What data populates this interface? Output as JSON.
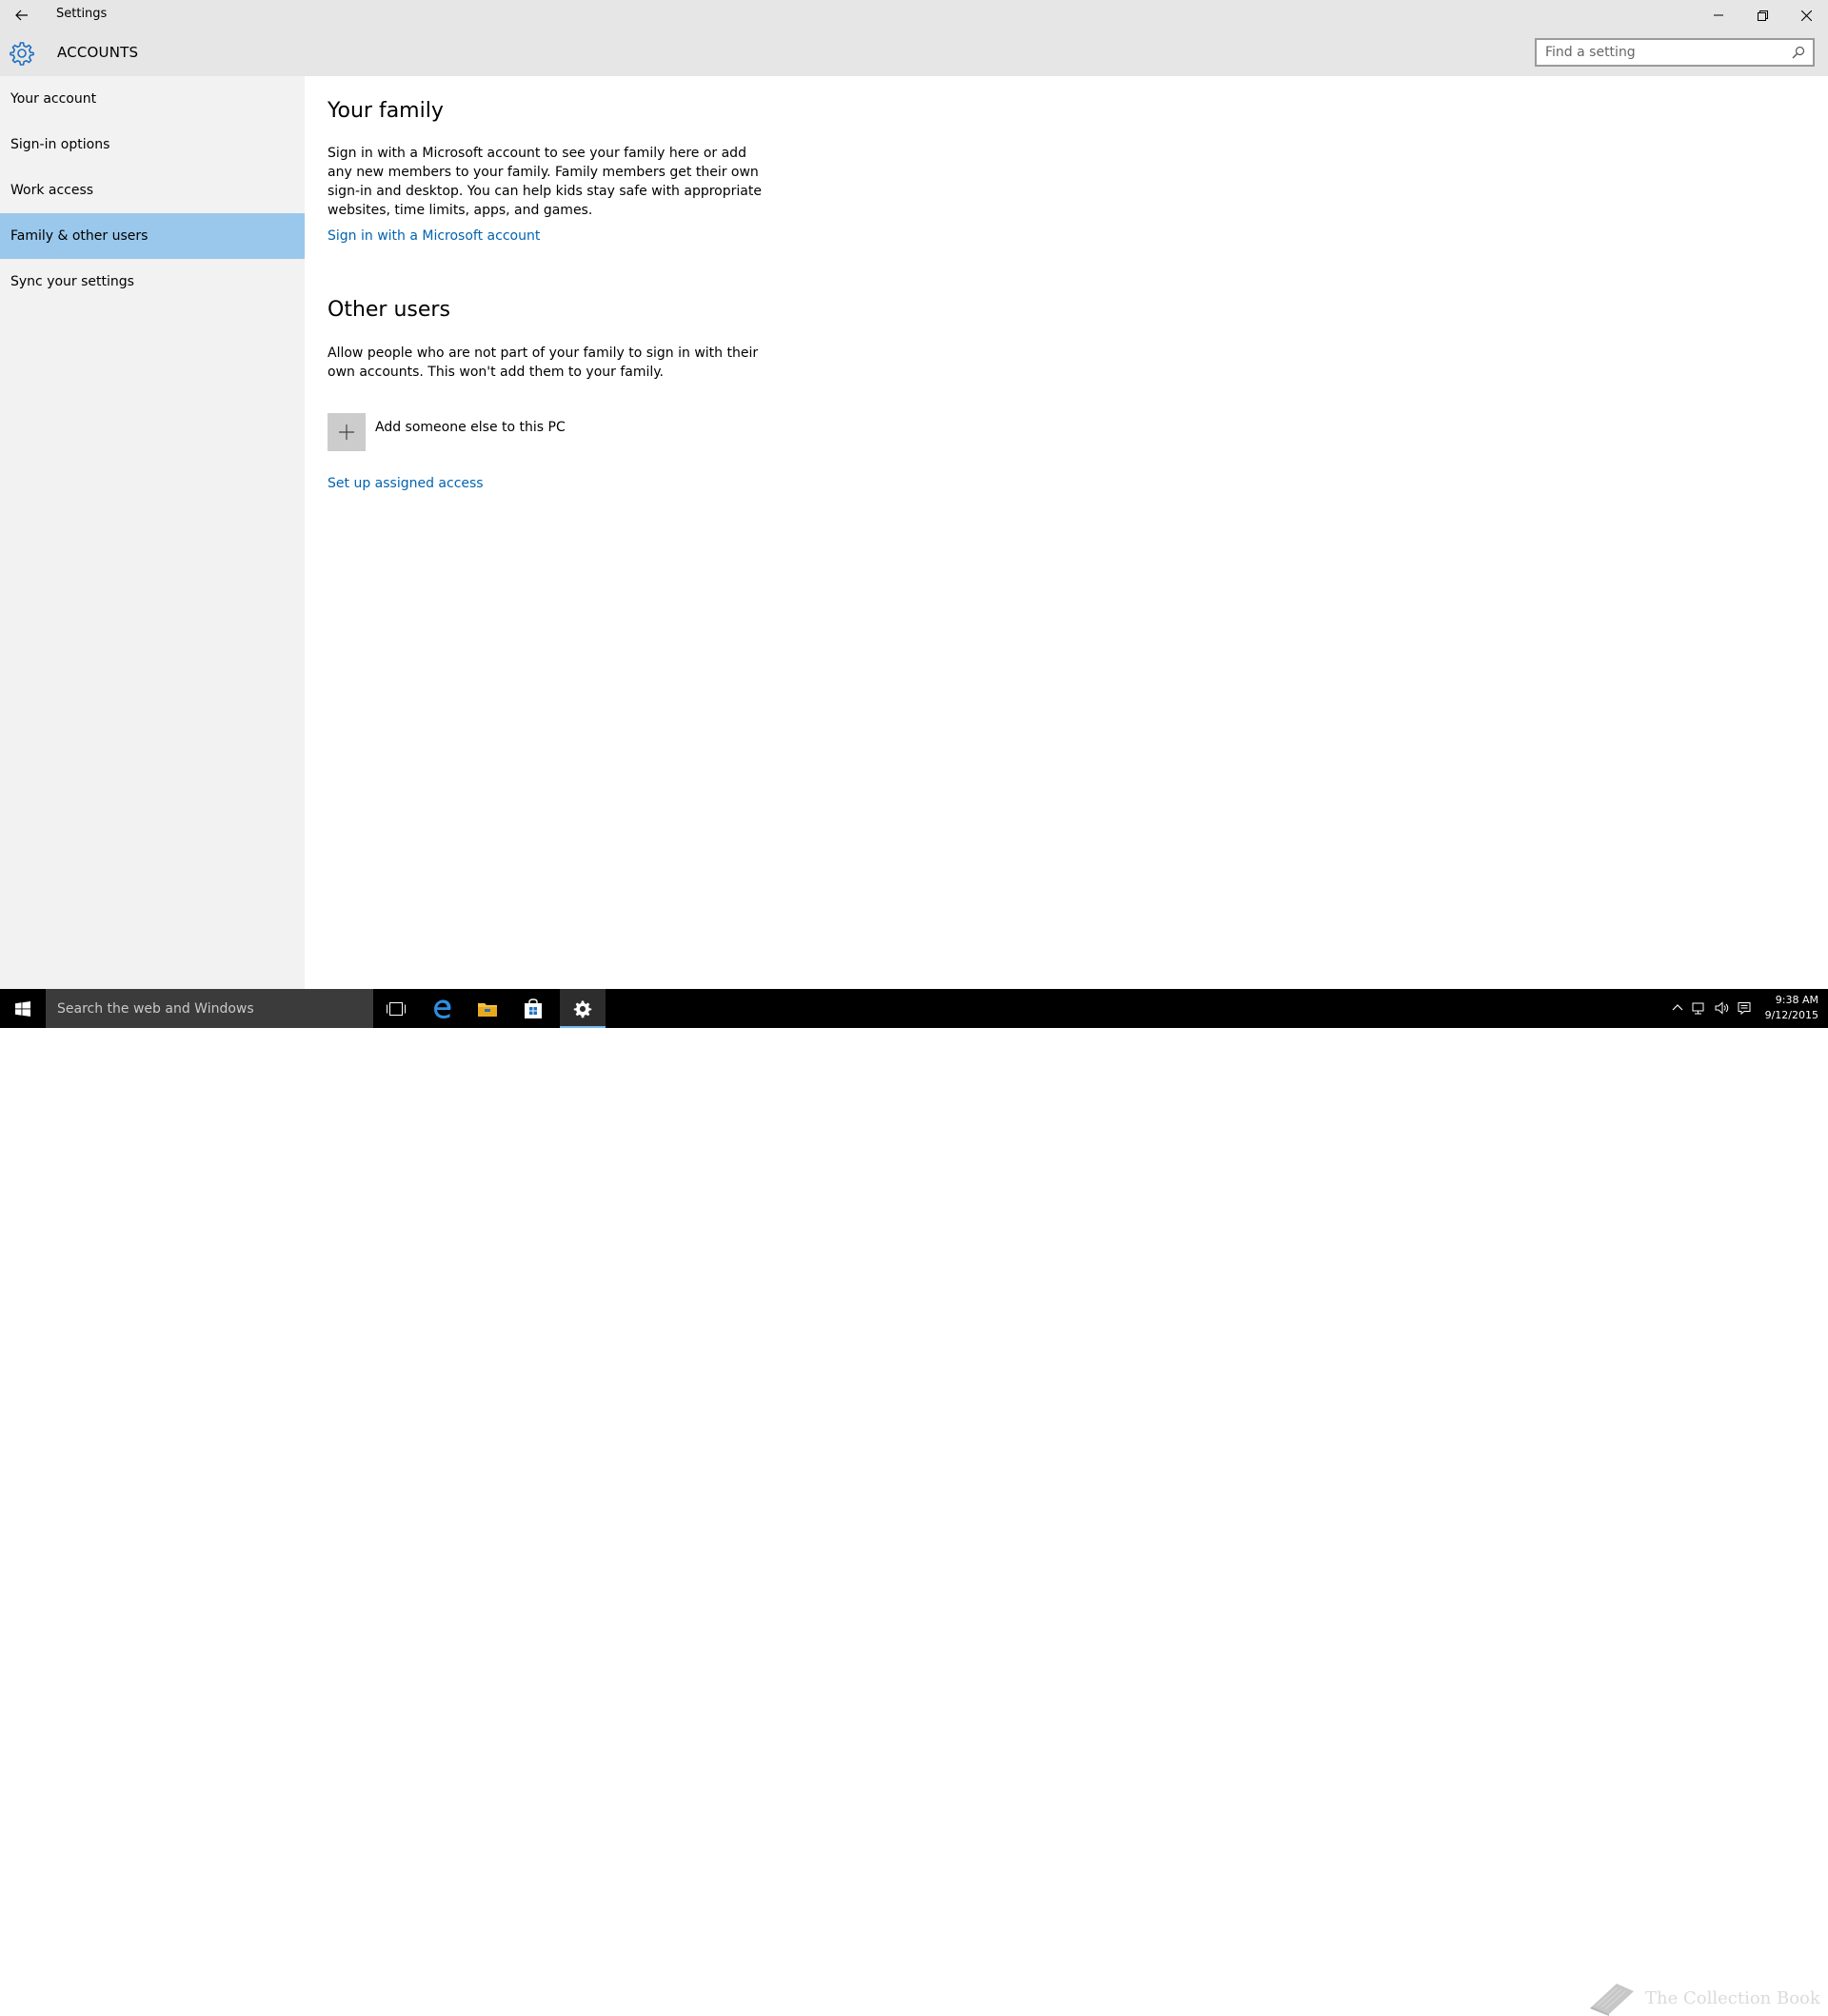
{
  "window": {
    "title": "Settings",
    "app_title": "ACCOUNTS"
  },
  "search": {
    "placeholder": "Find a setting"
  },
  "sidebar": {
    "items": [
      {
        "label": "Your account",
        "selected": false
      },
      {
        "label": "Sign-in options",
        "selected": false
      },
      {
        "label": "Work access",
        "selected": false
      },
      {
        "label": "Family & other users",
        "selected": true
      },
      {
        "label": "Sync your settings",
        "selected": false
      }
    ]
  },
  "family": {
    "heading": "Your family",
    "description": "Sign in with a Microsoft account to see your family here or add any new members to your family. Family members get their own sign-in and desktop. You can help kids stay safe with appropriate websites, time limits, apps, and games.",
    "link": "Sign in with a Microsoft account"
  },
  "other_users": {
    "heading": "Other users",
    "description": "Allow people who are not part of your family to sign in with their own accounts. This won't add them to your family.",
    "add_label": "Add someone else to this PC",
    "assigned_access_link": "Set up assigned access"
  },
  "taskbar": {
    "search_placeholder": "Search the web and Windows",
    "watermark": "The Collection Book",
    "time": "9:38 AM",
    "date": "9/12/2015"
  },
  "colors": {
    "accent": "#0063b1",
    "selected_nav": "#99c8ec",
    "chrome": "#e6e6e6",
    "sidebar": "#f2f2f2"
  }
}
